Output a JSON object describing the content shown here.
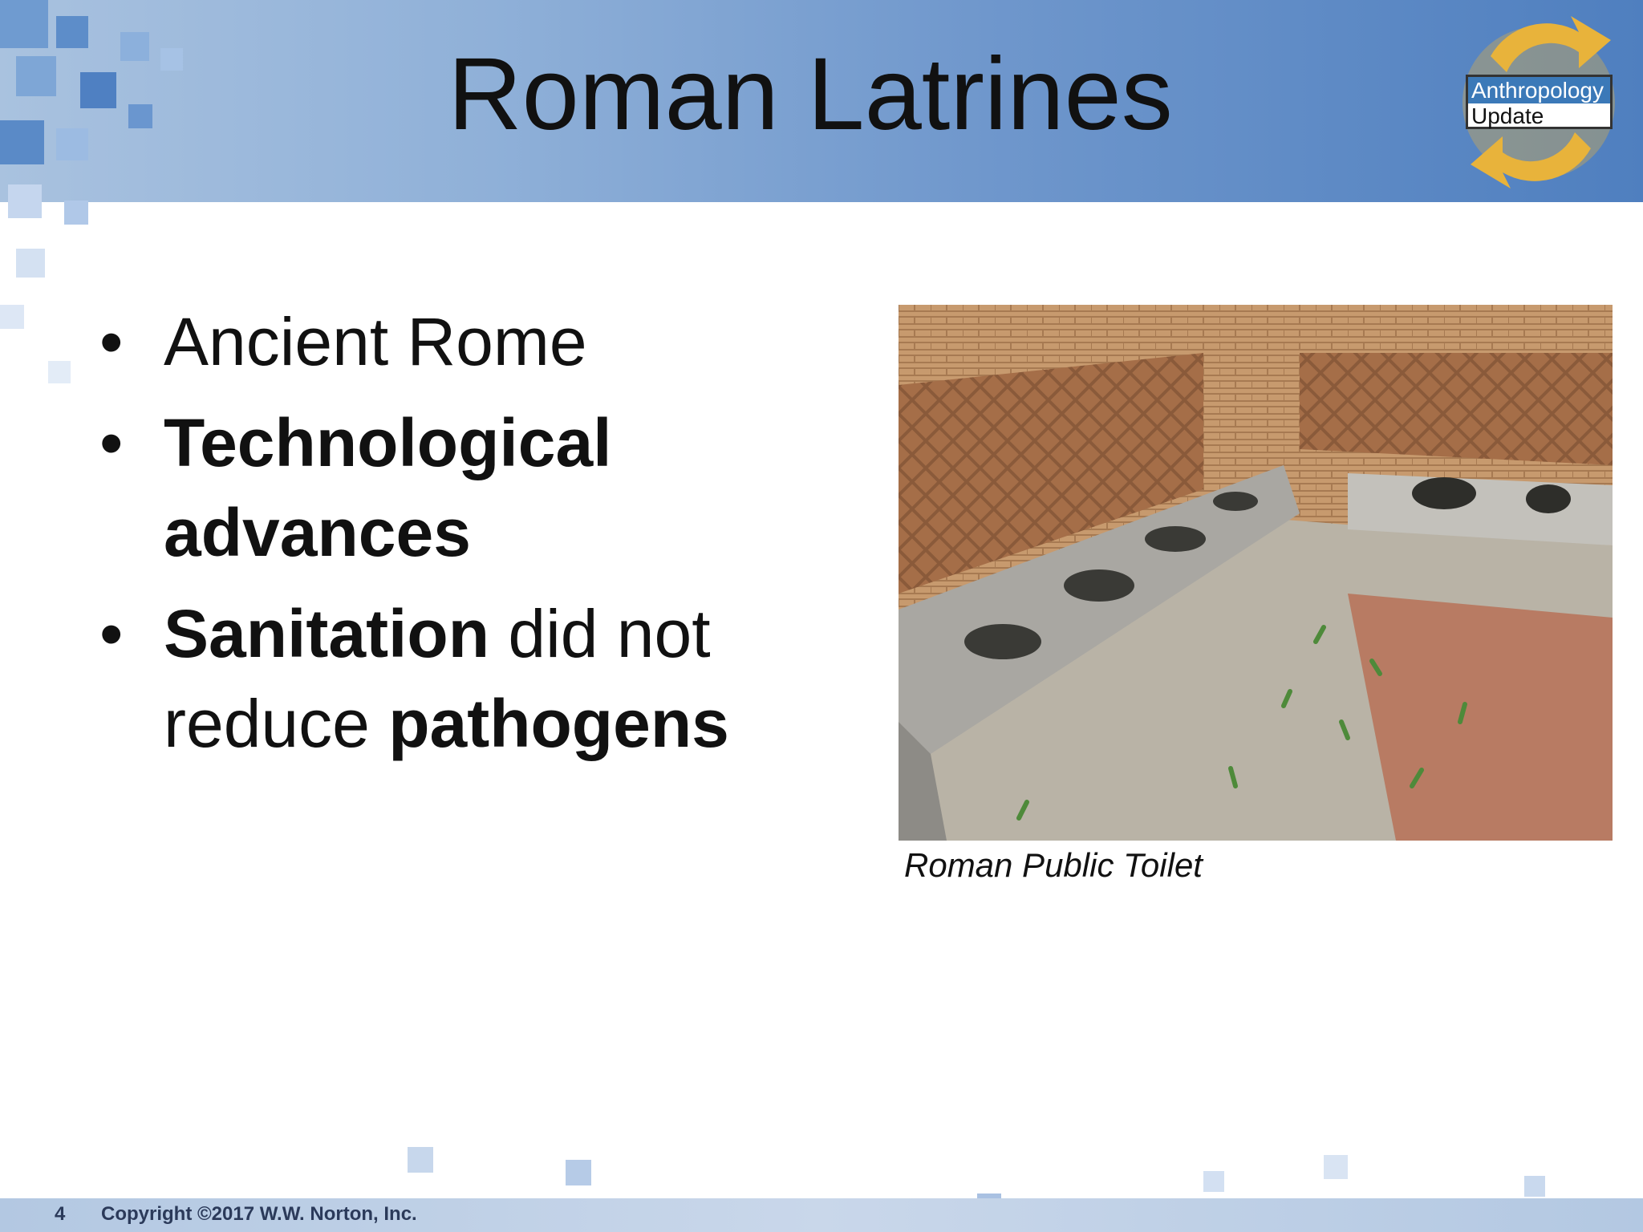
{
  "slide": {
    "title": "Roman Latrines",
    "logo": {
      "line1": "Anthropology",
      "line2": "Update"
    },
    "bullets": [
      {
        "segments": [
          {
            "text": "Ancient Rome",
            "bold": false
          }
        ]
      },
      {
        "segments": [
          {
            "text": "Technological advances",
            "bold": true
          }
        ]
      },
      {
        "segments": [
          {
            "text": "Sanitation",
            "bold": true
          },
          {
            "text": " did not reduce ",
            "bold": false
          },
          {
            "text": "pathogens",
            "bold": true
          }
        ]
      }
    ],
    "bullet_symbol": "•",
    "image_caption": "Roman Public Toilet",
    "page_number": "4",
    "copyright": "Copyright ©2017 W.W. Norton, Inc."
  },
  "colors": {
    "header_blue": "#6f97cc",
    "logo_blue": "#3b79b8",
    "logo_gold": "#e8b33b",
    "footer_text": "#2b3a5a"
  }
}
